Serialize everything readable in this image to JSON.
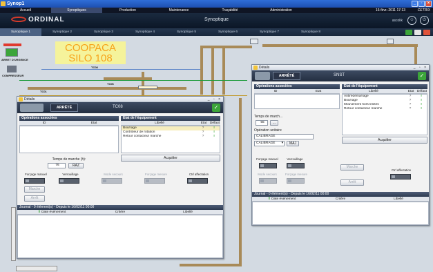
{
  "window": {
    "title": "Synop1"
  },
  "menu": {
    "items": [
      "Accueil",
      "Synoptiques",
      "Production",
      "Maintenance",
      "Traçabilité",
      "Administration"
    ],
    "active_index": 1,
    "datetime": "16-févr.-2011 17:13",
    "brand_small": "CETRIX"
  },
  "brand": {
    "logo": "ORDINAL",
    "screen_title": "Synoptique",
    "account_label": "ascolik"
  },
  "tabs": {
    "items": [
      "Synoptique 1",
      "Synoptique 2",
      "Synoptique 3",
      "Synoptique 4",
      "Synoptique 5",
      "Synoptique 6",
      "Synoptique 7",
      "Synoptique 8"
    ],
    "active_index": 0
  },
  "synoptic": {
    "site_name_1": "COOPACA",
    "site_name_2": "SILO 108",
    "labels": {
      "arret_urgence": "ARRET D'URGENCE",
      "compresseur": "COMPRESSEUR",
      "tc08": "TC08",
      "tc06": "TC06",
      "tc01": "TC01"
    }
  },
  "win_left": {
    "title": "Détails",
    "state": "ARRÊTÉ",
    "equipment": "TC08",
    "ops": {
      "header": "Opérations associées",
      "col_id": "ID",
      "col_etat": "Etat"
    },
    "runtime": {
      "label": "Temps de marche (h):",
      "value": "76",
      "reset": "RAZ"
    },
    "eq_state": {
      "header": "Etat de l'équipement",
      "col_libelle": "Libellé",
      "col_etat": "Etat",
      "col_defaut": "Défaut",
      "rows": [
        {
          "label": "Bourrage",
          "etat": "?",
          "defaut": "!"
        },
        {
          "label": "Contrôleur de rotation",
          "etat": "?",
          "defaut": "!"
        },
        {
          "label": "Retour contacteur marche",
          "etat": "?",
          "defaut": "!"
        }
      ],
      "ack": "Acquitter"
    },
    "controls": {
      "forcage_manuel": "Forçage manuel",
      "verrouillage": "Verrouillage",
      "mode_secours": "Mode secours",
      "forcage_mesure": "Forçage mesure",
      "ctrl_affectation": "Ctrl affectation",
      "marche": "Marche",
      "arret": "Arrêt"
    },
    "journal": {
      "header": "Journal - 0 élément(s) - Depuis le 16/02/11 00:00",
      "col_date": "Date événement",
      "col_critere": "Critère",
      "col_libelle": "Libellé"
    }
  },
  "win_right": {
    "title": "Détails",
    "state": "ARRÊTÉ",
    "equipment": "SNST",
    "ops": {
      "header": "Opérations associées",
      "col_id": "ID",
      "col_etat": "Etat"
    },
    "runtime": {
      "label": "Temps de march...",
      "value": "55",
      "btn": "..."
    },
    "unit_op": {
      "label": "Opération unitaire",
      "value": "CALIBRAGE",
      "select": "CALIBRAGE",
      "maj": "MAJ"
    },
    "eq_state": {
      "header": "Etat de l'équipement",
      "col_libelle": "Libellé",
      "col_etat": "Etat",
      "col_defaut": "Défaut",
      "rows": [
        {
          "label": "Antirédémarrage",
          "etat": "?",
          "defaut": "!"
        },
        {
          "label": "Bourrage",
          "etat": "?",
          "defaut": "!"
        },
        {
          "label": "Mouvement hors limites",
          "etat": "?",
          "defaut": "!"
        },
        {
          "label": "Retour contacteur marche",
          "etat": "?",
          "defaut": "!"
        }
      ],
      "ack": "Acquitter"
    },
    "controls": {
      "forcage_manuel": "Forçage manuel",
      "verrouillage": "Verrouillage",
      "mode_secours": "Mode secours",
      "forcage_mesure": "Forçage mesure",
      "marche": "Marche",
      "arret": "Arrêt",
      "ctrl_affectation": "Ctrl affectation"
    },
    "journal": {
      "header": "Journal - 0 élément(s) - Depuis le 16/02/11 00:00",
      "col_date": "Date événement",
      "col_critere": "Critère",
      "col_libelle": "Libellé"
    }
  },
  "colors": {
    "accent": "#1d4fb0",
    "coopaca_bg": "#f5f39b",
    "coopaca_text": "#f7a31a",
    "pipe": "#a88a58",
    "ok_green": "#3ca53a"
  }
}
